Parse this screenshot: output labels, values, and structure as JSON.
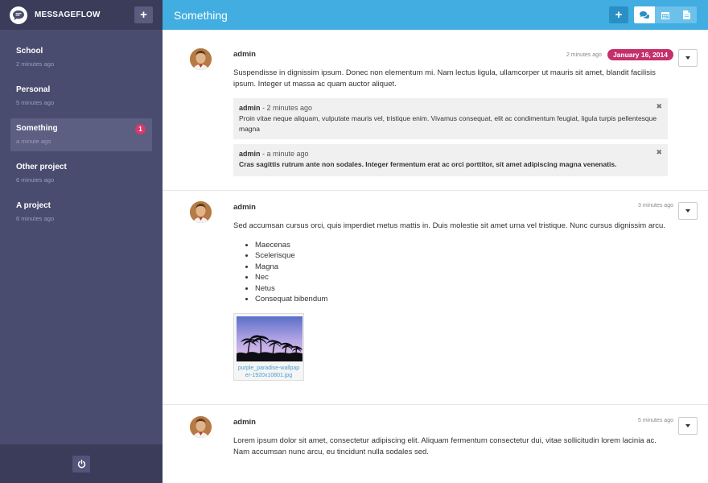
{
  "app": {
    "name": "MESSAGEFLOW"
  },
  "sidebar": {
    "projects": [
      {
        "name": "School",
        "time": "2 minutes ago"
      },
      {
        "name": "Personal",
        "time": "5 minutes ago"
      },
      {
        "name": "Something",
        "time": "a minute ago",
        "badge": "1"
      },
      {
        "name": "Other project",
        "time": "6 minutes ago"
      },
      {
        "name": "A project",
        "time": "6 minutes ago"
      }
    ],
    "active_index": 2
  },
  "topbar": {
    "title": "Something"
  },
  "messages": [
    {
      "author": "admin",
      "time": "2 minutes ago",
      "date_badge": "January 16, 2014",
      "body": "Suspendisse in dignissim ipsum. Donec non elementum mi. Nam lectus ligula, ullamcorper ut mauris sit amet, blandit facilisis ipsum. Integer ut massa ac quam auctor aliquet.",
      "comments": [
        {
          "author": "admin",
          "time": "- 2 minutes ago",
          "text": "Proin vitae neque aliquam, vulputate mauris vel, tristique enim. Vivamus consequat, elit ac condimentum feugiat, ligula turpis pellentesque magna"
        },
        {
          "author": "admin",
          "time": "- a minute ago",
          "text": "Cras sagittis rutrum ante non sodales. Integer fermentum erat ac orci porttitor, sit amet adipiscing magna venenatis."
        }
      ]
    },
    {
      "author": "admin",
      "time": "3 minutes ago",
      "body": "Sed accumsan cursus orci, quis imperdiet metus mattis in. Duis molestie sit amet urna vel tristique. Nunc cursus dignissim arcu.",
      "list": [
        "Maecenas",
        "Scelerisque",
        "Magna",
        "Nec",
        "Netus",
        "Consequat bibendum"
      ],
      "attachment": {
        "name": "purple_paradise-wallpaper-1920x10801.jpg"
      }
    },
    {
      "author": "admin",
      "time": "5 minutes ago",
      "body": "Lorem ipsum dolor sit amet, consectetur adipiscing elit. Aliquam fermentum consectetur dui, vitae sollicitudin lorem lacinia ac. Nam accumsan nunc arcu, eu tincidunt nulla sodales sed."
    }
  ],
  "colors": {
    "sidebar_bg": "#4a4c6f",
    "sidebar_header_bg": "#3a3c5a",
    "topbar_bg": "#41ade0",
    "badge": "#d63a6c",
    "date_badge": "#c4306a",
    "link": "#4a9ed0"
  },
  "icons": {
    "logo": "chat-bubble-icon",
    "add": "plus-icon",
    "power": "power-icon",
    "chat": "comments-icon",
    "calendar": "calendar-icon",
    "file": "file-icon",
    "dropdown": "caret-down-icon",
    "close": "close-icon"
  }
}
